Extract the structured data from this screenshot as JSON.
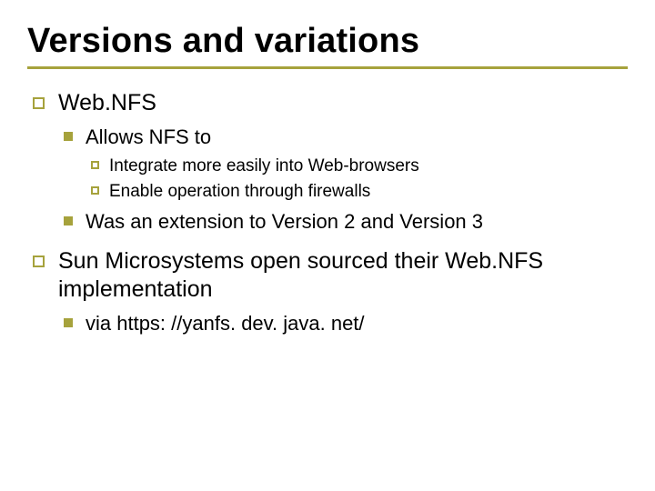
{
  "title": "Versions and variations",
  "items": [
    {
      "text": "Web.NFS",
      "children": [
        {
          "text": "Allows NFS to",
          "children": [
            {
              "text": "Integrate more easily into Web-browsers"
            },
            {
              "text": "Enable operation through firewalls"
            }
          ]
        },
        {
          "text": "Was an extension to Version 2 and Version 3"
        }
      ]
    },
    {
      "text": "Sun Microsystems open sourced their Web.NFS implementation",
      "children": [
        {
          "text": "via https: //yanfs. dev. java. net/"
        }
      ]
    }
  ]
}
